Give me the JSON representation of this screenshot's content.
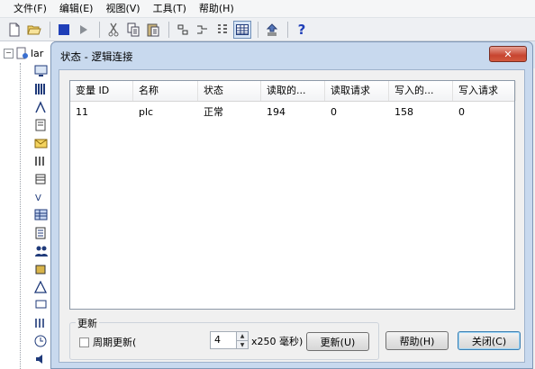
{
  "menubar": {
    "items": [
      "文件(F)",
      "编辑(E)",
      "视图(V)",
      "工具(T)",
      "帮助(H)"
    ]
  },
  "toolbar": {
    "buttons": [
      "new-file-icon",
      "open-folder-icon",
      "stop-icon",
      "run-icon",
      "cut-icon",
      "copy-icon",
      "paste-icon",
      "align-icon",
      "connect-icon",
      "grid-icon",
      "table-view-icon",
      "upload-icon",
      "help-icon"
    ],
    "help_glyph": "?"
  },
  "tree": {
    "root_label": "lar",
    "expander": "−"
  },
  "dialog": {
    "title": "状态 - 逻辑连接",
    "close_glyph": "✕",
    "list": {
      "columns": [
        "变量 ID",
        "名称",
        "状态",
        "读取的...",
        "读取请求",
        "写入的...",
        "写入请求"
      ],
      "rows": [
        [
          "11",
          "plc",
          "正常",
          "194",
          "0",
          "158",
          "0"
        ]
      ]
    },
    "refresh_group": {
      "title": "更新",
      "periodic_label": "周期更新(",
      "periodic_checked": false,
      "interval_value": "4",
      "unit_label": "x250 毫秒)",
      "refresh_button": "更新(U)"
    },
    "help_button": "帮助(H)",
    "close_button": "关闭(C)"
  },
  "colors": {
    "title_bar": "#c8d9ee",
    "close_red": "#c7442f",
    "default_button_border": "#3c7fb1"
  }
}
